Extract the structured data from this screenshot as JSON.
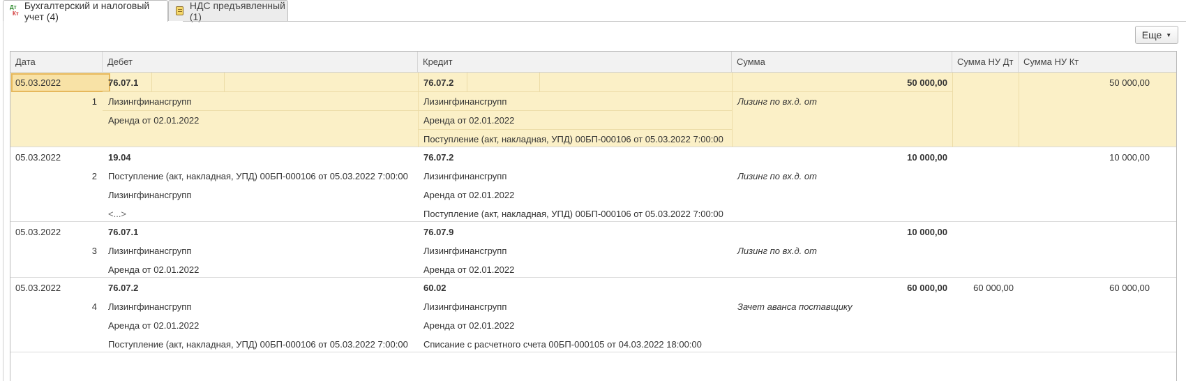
{
  "tabs": [
    {
      "label": "Бухгалтерский и налоговый учет (4)",
      "icon": "dt-kt-icon"
    },
    {
      "label": "НДС предъявленный (1)",
      "icon": "document-icon"
    }
  ],
  "toolbar": {
    "more_label": "Еще"
  },
  "columns": {
    "date": "Дата",
    "debit": "Дебет",
    "credit": "Кредит",
    "sum": "Сумма",
    "sum_nu_dt": "Сумма НУ Дт",
    "sum_nu_kt": "Сумма НУ Кт"
  },
  "rows": [
    {
      "date": "05.03.2022",
      "num": "1",
      "debit_account": "76.07.1",
      "debit_sub1": "Лизингфинансгрупп",
      "debit_sub2": "Аренда от 02.01.2022",
      "debit_sub3": "",
      "credit_account": "76.07.2",
      "credit_sub1": "Лизингфинансгрупп",
      "credit_sub2": "Аренда от 02.01.2022",
      "credit_sub3": "Поступление (акт, накладная, УПД) 00БП-000106 от 05.03.2022 7:00:00",
      "sum": "50 000,00",
      "content": "Лизинг по вх.д.  от",
      "sum_nu_dt": "",
      "sum_nu_kt": "50 000,00"
    },
    {
      "date": "05.03.2022",
      "num": "2",
      "debit_account": "19.04",
      "debit_sub1": "Поступление (акт, накладная, УПД) 00БП-000106 от 05.03.2022 7:00:00",
      "debit_sub2": "Лизингфинансгрупп",
      "debit_sub3": "<...>",
      "credit_account": "76.07.2",
      "credit_sub1": "Лизингфинансгрупп",
      "credit_sub2": "Аренда от 02.01.2022",
      "credit_sub3": "Поступление (акт, накладная, УПД) 00БП-000106 от 05.03.2022 7:00:00",
      "sum": "10 000,00",
      "content": "Лизинг по вх.д.  от",
      "sum_nu_dt": "",
      "sum_nu_kt": "10 000,00"
    },
    {
      "date": "05.03.2022",
      "num": "3",
      "debit_account": "76.07.1",
      "debit_sub1": "Лизингфинансгрупп",
      "debit_sub2": "Аренда от 02.01.2022",
      "debit_sub3": "",
      "credit_account": "76.07.9",
      "credit_sub1": "Лизингфинансгрупп",
      "credit_sub2": "Аренда от 02.01.2022",
      "credit_sub3": "",
      "sum": "10 000,00",
      "content": "Лизинг по вх.д.  от",
      "sum_nu_dt": "",
      "sum_nu_kt": ""
    },
    {
      "date": "05.03.2022",
      "num": "4",
      "debit_account": "76.07.2",
      "debit_sub1": "Лизингфинансгрупп",
      "debit_sub2": "Аренда от 02.01.2022",
      "debit_sub3": "Поступление (акт, накладная, УПД) 00БП-000106 от 05.03.2022 7:00:00",
      "credit_account": "60.02",
      "credit_sub1": "Лизингфинансгрупп",
      "credit_sub2": "Аренда от 02.01.2022",
      "credit_sub3": "Списание с расчетного счета 00БП-000105 от 04.03.2022 18:00:00",
      "sum": "60 000,00",
      "content": "Зачет аванса поставщику",
      "sum_nu_dt": "60 000,00",
      "sum_nu_kt": "60 000,00"
    }
  ]
}
